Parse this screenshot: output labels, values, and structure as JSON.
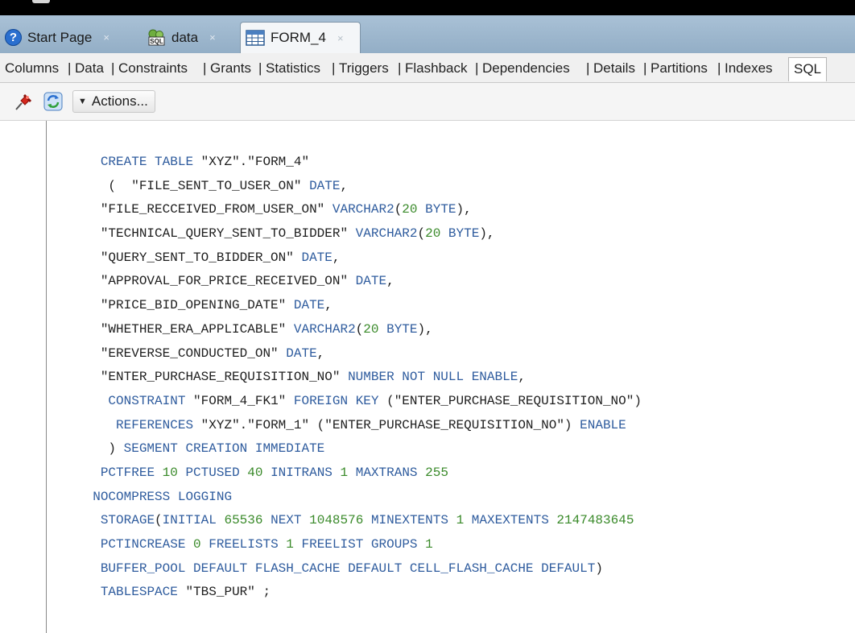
{
  "window": {
    "tabs": [
      {
        "label": "Start Page",
        "icon": "help-icon",
        "active": false
      },
      {
        "label": "data",
        "icon": "sql-connection-icon",
        "active": false
      },
      {
        "label": "FORM_4",
        "icon": "table-icon",
        "active": true
      }
    ],
    "close_glyph": "×"
  },
  "subtabs": [
    "Columns",
    "Data",
    "Constraints",
    "Grants",
    "Statistics",
    "Triggers",
    "Flashback",
    "Dependencies",
    "Details",
    "Partitions",
    "Indexes",
    "SQL"
  ],
  "subtab_separator": "|",
  "active_subtab": "SQL",
  "toolbar": {
    "pin_icon": "pin-icon",
    "refresh_icon": "refresh-icon",
    "actions_label": "Actions..."
  },
  "colors": {
    "keyword": "#2f5c9e",
    "number": "#3a8a2a",
    "text": "#1e1e1e",
    "tabstrip": "#a9c1d6"
  },
  "sql_lines": [
    [
      {
        "t": "   "
      },
      {
        "t": "CREATE TABLE ",
        "k": "kw"
      },
      {
        "t": "\"XYZ\".\"FORM_4\""
      }
    ],
    [
      {
        "t": "    (  \"FILE_SENT_TO_USER_ON\" "
      },
      {
        "t": "DATE",
        "k": "kw"
      },
      {
        "t": ","
      }
    ],
    [
      {
        "t": "   \"FILE_RECCEIVED_FROM_USER_ON\" "
      },
      {
        "t": "VARCHAR2",
        "k": "kw"
      },
      {
        "t": "("
      },
      {
        "t": "20",
        "k": "nm"
      },
      {
        "t": " "
      },
      {
        "t": "BYTE",
        "k": "kw"
      },
      {
        "t": "),"
      }
    ],
    [
      {
        "t": "   \"TECHNICAL_QUERY_SENT_TO_BIDDER\" "
      },
      {
        "t": "VARCHAR2",
        "k": "kw"
      },
      {
        "t": "("
      },
      {
        "t": "20",
        "k": "nm"
      },
      {
        "t": " "
      },
      {
        "t": "BYTE",
        "k": "kw"
      },
      {
        "t": "),"
      }
    ],
    [
      {
        "t": "   \"QUERY_SENT_TO_BIDDER_ON\" "
      },
      {
        "t": "DATE",
        "k": "kw"
      },
      {
        "t": ","
      }
    ],
    [
      {
        "t": "   \"APPROVAL_FOR_PRICE_RECEIVED_ON\" "
      },
      {
        "t": "DATE",
        "k": "kw"
      },
      {
        "t": ","
      }
    ],
    [
      {
        "t": "   \"PRICE_BID_OPENING_DATE\" "
      },
      {
        "t": "DATE",
        "k": "kw"
      },
      {
        "t": ","
      }
    ],
    [
      {
        "t": "   \"WHETHER_ERA_APPLICABLE\" "
      },
      {
        "t": "VARCHAR2",
        "k": "kw"
      },
      {
        "t": "("
      },
      {
        "t": "20",
        "k": "nm"
      },
      {
        "t": " "
      },
      {
        "t": "BYTE",
        "k": "kw"
      },
      {
        "t": "),"
      }
    ],
    [
      {
        "t": "   \"EREVERSE_CONDUCTED_ON\" "
      },
      {
        "t": "DATE",
        "k": "kw"
      },
      {
        "t": ","
      }
    ],
    [
      {
        "t": "   \"ENTER_PURCHASE_REQUISITION_NO\" "
      },
      {
        "t": "NUMBER NOT NULL ENABLE",
        "k": "kw"
      },
      {
        "t": ","
      }
    ],
    [
      {
        "t": "    "
      },
      {
        "t": "CONSTRAINT ",
        "k": "kw"
      },
      {
        "t": "\"FORM_4_FK1\" "
      },
      {
        "t": "FOREIGN KEY ",
        "k": "kw"
      },
      {
        "t": "(\"ENTER_PURCHASE_REQUISITION_NO\")"
      }
    ],
    [
      {
        "t": "     "
      },
      {
        "t": "REFERENCES ",
        "k": "kw"
      },
      {
        "t": "\"XYZ\".\"FORM_1\" (\"ENTER_PURCHASE_REQUISITION_NO\") "
      },
      {
        "t": "ENABLE",
        "k": "kw"
      }
    ],
    [
      {
        "t": "    ) "
      },
      {
        "t": "SEGMENT CREATION IMMEDIATE",
        "k": "kw"
      }
    ],
    [
      {
        "t": "   "
      },
      {
        "t": "PCTFREE ",
        "k": "kw"
      },
      {
        "t": "10",
        "k": "nm"
      },
      {
        "t": " "
      },
      {
        "t": "PCTUSED ",
        "k": "kw"
      },
      {
        "t": "40",
        "k": "nm"
      },
      {
        "t": " "
      },
      {
        "t": "INITRANS ",
        "k": "kw"
      },
      {
        "t": "1",
        "k": "nm"
      },
      {
        "t": " "
      },
      {
        "t": "MAXTRANS ",
        "k": "kw"
      },
      {
        "t": "255",
        "k": "nm"
      }
    ],
    [
      {
        "t": "  "
      },
      {
        "t": "NOCOMPRESS LOGGING",
        "k": "kw"
      }
    ],
    [
      {
        "t": "   "
      },
      {
        "t": "STORAGE",
        "k": "kw"
      },
      {
        "t": "("
      },
      {
        "t": "INITIAL ",
        "k": "kw"
      },
      {
        "t": "65536",
        "k": "nm"
      },
      {
        "t": " "
      },
      {
        "t": "NEXT ",
        "k": "kw"
      },
      {
        "t": "1048576",
        "k": "nm"
      },
      {
        "t": " "
      },
      {
        "t": "MINEXTENTS ",
        "k": "kw"
      },
      {
        "t": "1",
        "k": "nm"
      },
      {
        "t": " "
      },
      {
        "t": "MAXEXTENTS ",
        "k": "kw"
      },
      {
        "t": "2147483645",
        "k": "nm"
      }
    ],
    [
      {
        "t": "   "
      },
      {
        "t": "PCTINCREASE ",
        "k": "kw"
      },
      {
        "t": "0",
        "k": "nm"
      },
      {
        "t": " "
      },
      {
        "t": "FREELISTS ",
        "k": "kw"
      },
      {
        "t": "1",
        "k": "nm"
      },
      {
        "t": " "
      },
      {
        "t": "FREELIST GROUPS ",
        "k": "kw"
      },
      {
        "t": "1",
        "k": "nm"
      }
    ],
    [
      {
        "t": "   "
      },
      {
        "t": "BUFFER_POOL DEFAULT FLASH_CACHE DEFAULT CELL_FLASH_CACHE DEFAULT",
        "k": "kw"
      },
      {
        "t": ")"
      }
    ],
    [
      {
        "t": "   "
      },
      {
        "t": "TABLESPACE ",
        "k": "kw"
      },
      {
        "t": "\"TBS_PUR\" ;"
      }
    ]
  ]
}
